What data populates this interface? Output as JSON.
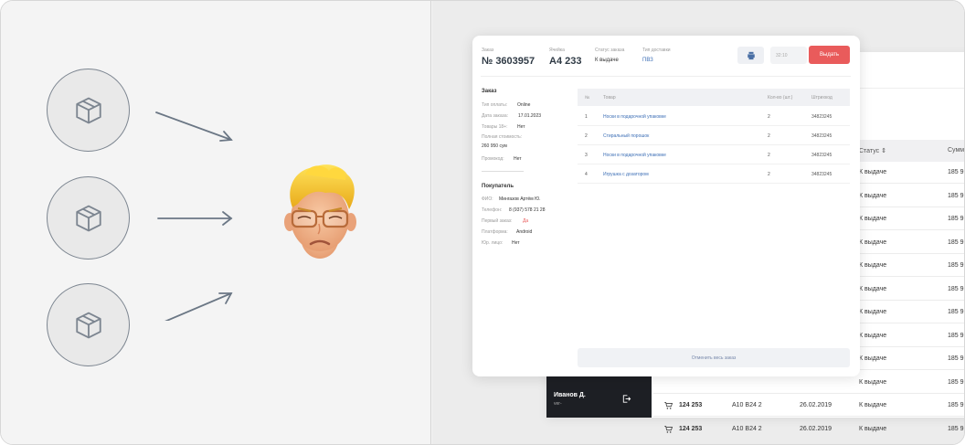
{
  "colors": {
    "accent_red": "#e95b5b",
    "dark_sidebar": "#1d1f24",
    "link_blue": "#3d6fb6"
  },
  "left_panel": {
    "packages": [
      {
        "icon": "package-icon"
      },
      {
        "icon": "package-icon"
      },
      {
        "icon": "package-icon"
      }
    ],
    "avatar": {
      "icon": "frowning-memoji-avatar"
    }
  },
  "order_card": {
    "order_label": "Заказ",
    "order_number": "№ 3603957",
    "cell_label": "Ячейка",
    "cell_value": "A4 233",
    "status_label": "Статус заказа",
    "status_value": "К выдаче",
    "delivery_label": "Тип доставки",
    "delivery_value": "ПВЗ",
    "time_placeholder": "32:10",
    "issue_button": "Выдать",
    "cancel_button": "Отменить весь заказ",
    "info": {
      "order_title": "Заказ",
      "payment_key": "Тип оплаты:",
      "payment_val": "Online",
      "date_key": "Дата заказа:",
      "date_val": "17.01.2023",
      "adult_key": "Товары 18+:",
      "adult_val": "Нет",
      "total_key": "Полная стоимость:",
      "total_val": "260 950 сум",
      "promo_key": "Промокод:",
      "promo_val": "Нет",
      "buyer_title": "Покупатель",
      "fio_key": "ФИО:",
      "fio_val": "Мингазов Артём Ю.",
      "phone_key": "Телефон:",
      "phone_val": "8 (937) 578 21 28",
      "first_key": "Первый заказ:",
      "first_val": "Да",
      "platform_key": "Платформа:",
      "platform_val": "Android",
      "legal_key": "Юр. лицо:",
      "legal_val": "Нет"
    },
    "items_headers": {
      "num": "№",
      "name": "Товар",
      "qty": "Кол-во (шт.)",
      "barcode": "Штрихкод"
    },
    "items": [
      {
        "num": "1",
        "name": "Носки в подарочной упаковке",
        "qty": "2",
        "barcode": "34823245"
      },
      {
        "num": "2",
        "name": "Стиральный порошок",
        "qty": "2",
        "barcode": "34823245"
      },
      {
        "num": "3",
        "name": "Носки в подарочной упаковке",
        "qty": "2",
        "barcode": "34823245"
      },
      {
        "num": "4",
        "name": "Игрушка с дозатором",
        "qty": "2",
        "barcode": "34823245"
      }
    ]
  },
  "background_list": {
    "headers": {
      "status": "Статус ⇕",
      "sum": "Сумм"
    },
    "rows": [
      {
        "status": "К выдаче",
        "sum": "185 9"
      },
      {
        "status": "К выдаче",
        "sum": "185 9"
      },
      {
        "status": "К выдаче",
        "sum": "185 9"
      },
      {
        "status": "К выдаче",
        "sum": "185 9"
      },
      {
        "status": "К выдаче",
        "sum": "185 9"
      },
      {
        "status": "К выдаче",
        "sum": "185 9"
      },
      {
        "status": "К выдаче",
        "sum": "185 9"
      },
      {
        "status": "К выдаче",
        "sum": "185 9"
      },
      {
        "status": "К выдаче",
        "sum": "185 9"
      },
      {
        "status": "К выдаче",
        "sum": "185 9"
      },
      {
        "id": "124 253",
        "cell": "A10 B24 2",
        "date": "26.02.2019",
        "status": "К выдаче",
        "sum": "185 9"
      },
      {
        "id": "124 253",
        "cell": "A10 B24 2",
        "date": "26.02.2019",
        "status": "К выдаче",
        "sum": "185 9"
      }
    ],
    "user_name": "Иванов Д.",
    "user_role": "ver-"
  }
}
